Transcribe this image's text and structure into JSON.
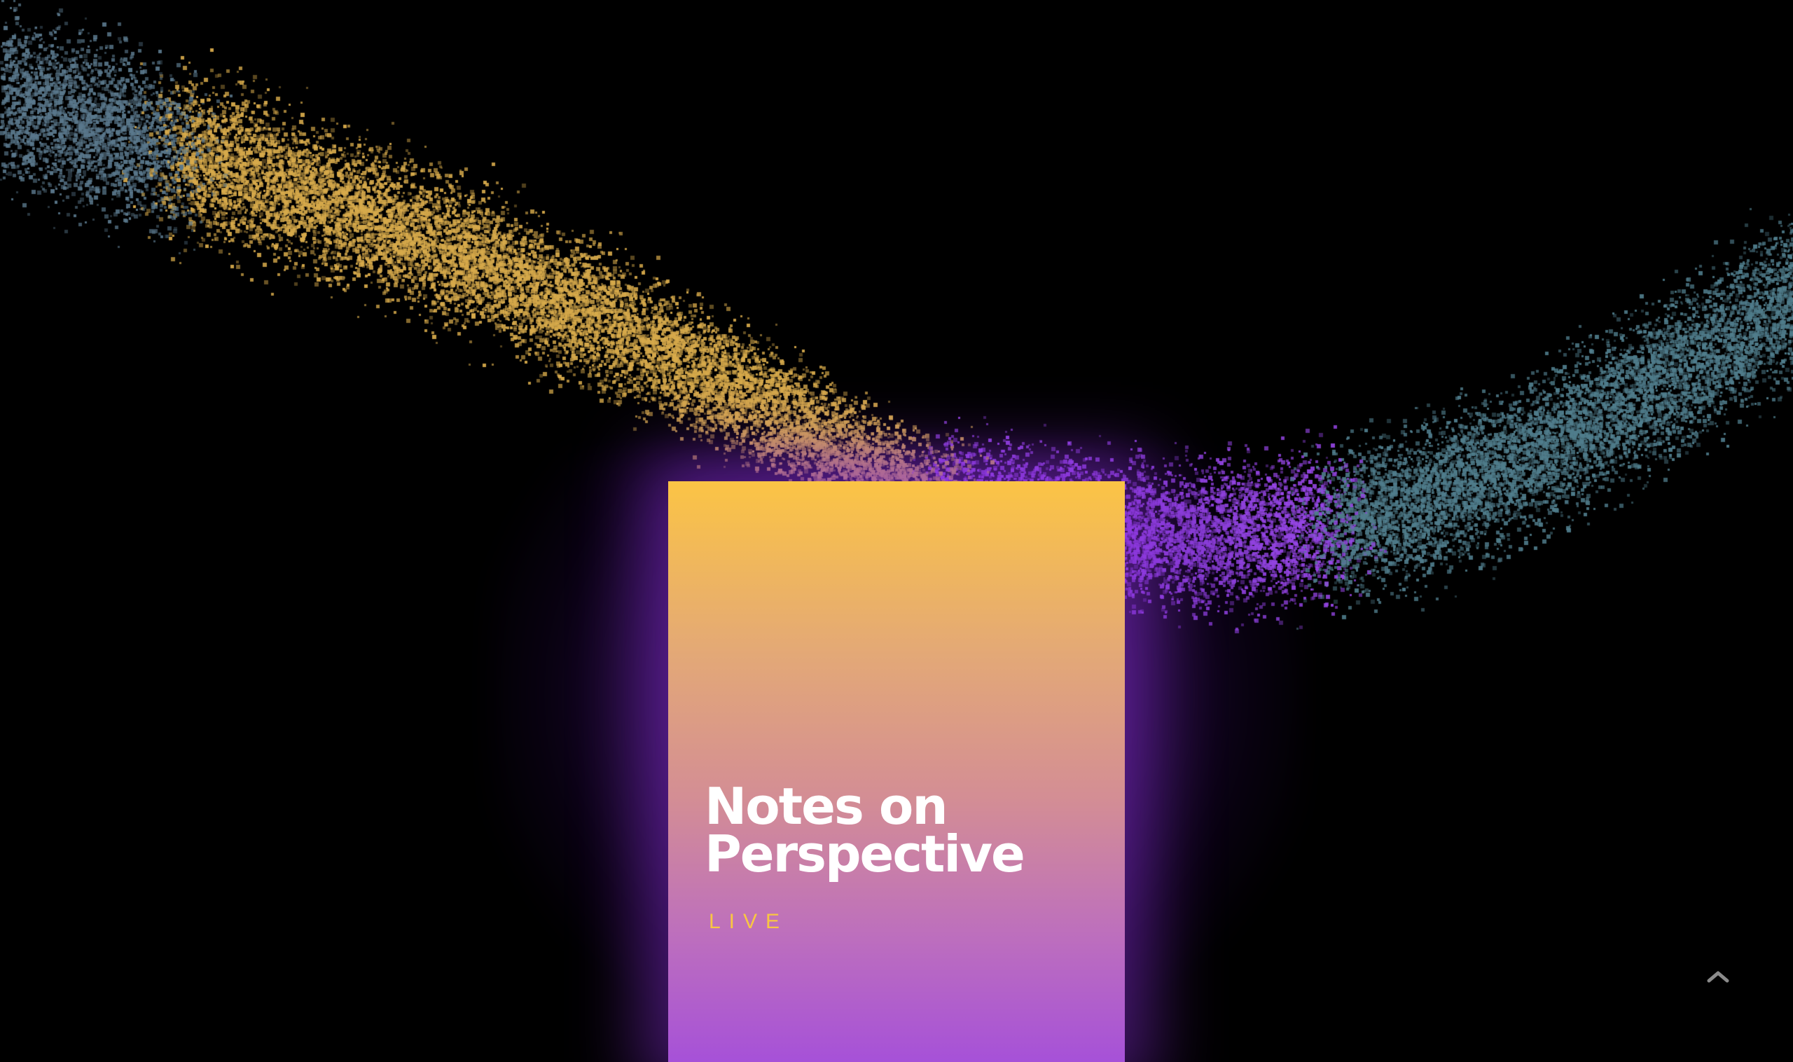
{
  "hero": {
    "title_line1": "Notes on",
    "title_line2": "Perspective",
    "subtitle": "LIVE"
  },
  "colors": {
    "background": "#000000",
    "card_top": "#fbc445",
    "card_bottom": "#a651d8",
    "accent_gold": "#f9c642",
    "glow_purple": "#9b3cf0",
    "particle_gold": "#d9a84a",
    "particle_teal": "#4f7f8a",
    "particle_purple": "#9a40e6"
  },
  "controls": {
    "scroll_top_icon": "chevron-up-icon"
  }
}
